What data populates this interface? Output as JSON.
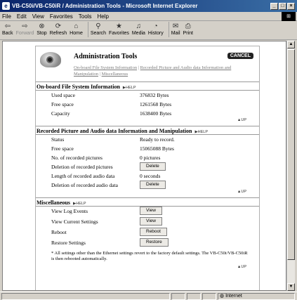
{
  "window": {
    "title": "VB-C50i/VB-C50iR / Administration Tools - Microsoft Internet Explorer",
    "icon": "ie-icon",
    "buttons": [
      "_",
      "□",
      "×"
    ]
  },
  "menu": [
    "File",
    "Edit",
    "View",
    "Favorites",
    "Tools",
    "Help"
  ],
  "toolbar": [
    {
      "label": "Back",
      "icon": "back-arrow"
    },
    {
      "label": "Forward",
      "icon": "forward-arrow",
      "disabled": true
    },
    {
      "label": "Stop",
      "icon": "stop"
    },
    {
      "label": "Refresh",
      "icon": "refresh"
    },
    {
      "label": "Home",
      "icon": "home"
    },
    {
      "label": "Search",
      "icon": "search"
    },
    {
      "label": "Favorites",
      "icon": "favorites"
    },
    {
      "label": "Media",
      "icon": "media"
    },
    {
      "label": "History",
      "icon": "history"
    },
    {
      "label": "Mail",
      "icon": "mail"
    },
    {
      "label": "Print",
      "icon": "print"
    }
  ],
  "page": {
    "title": "Administration Tools",
    "cancel": "CANCEL",
    "links": [
      "On-board File System Information",
      "Recorded Picture and Audio data Information and Manipulation",
      "Miscellaneous"
    ],
    "help": "▶HELP",
    "up": "▲UP",
    "sections": {
      "fs": {
        "title": "On-board File System Information",
        "rows": [
          {
            "label": "Used space",
            "value": "376832 Bytes"
          },
          {
            "label": "Free space",
            "value": "1261568 Bytes"
          },
          {
            "label": "Capacity",
            "value": "1638400 Bytes"
          }
        ]
      },
      "rec": {
        "title": "Recorded Picture and Audio data Information and Manipulation",
        "status_label": "Status",
        "status_value": "Ready to record.",
        "free_label": "Free space",
        "free_value": "15065088 Bytes",
        "num_label": "No. of recorded pictures",
        "num_value": "0 pictures",
        "delpic_label": "Deletion of recorded pictures",
        "delpic_btn": "Delete",
        "len_label": "Length of recorded audio data",
        "len_value": "0 seconds",
        "delaud_label": "Deletion of recorded audio data",
        "delaud_btn": "Delete"
      },
      "misc": {
        "title": "Miscellaneous",
        "log_label": "View Log Events",
        "log_btn": "View",
        "settings_label": "View Current Settings",
        "settings_btn": "View",
        "reboot_label": "Reboot",
        "reboot_btn": "Reboot",
        "restore_label": "Restore Settings",
        "restore_btn": "Restore",
        "note": "* All settings other than the Ethernet settings revert to the factory default settings. The VB-C50i/VB-C50iR is then rebooted automatically."
      }
    }
  },
  "status": {
    "zone": "Internet"
  }
}
